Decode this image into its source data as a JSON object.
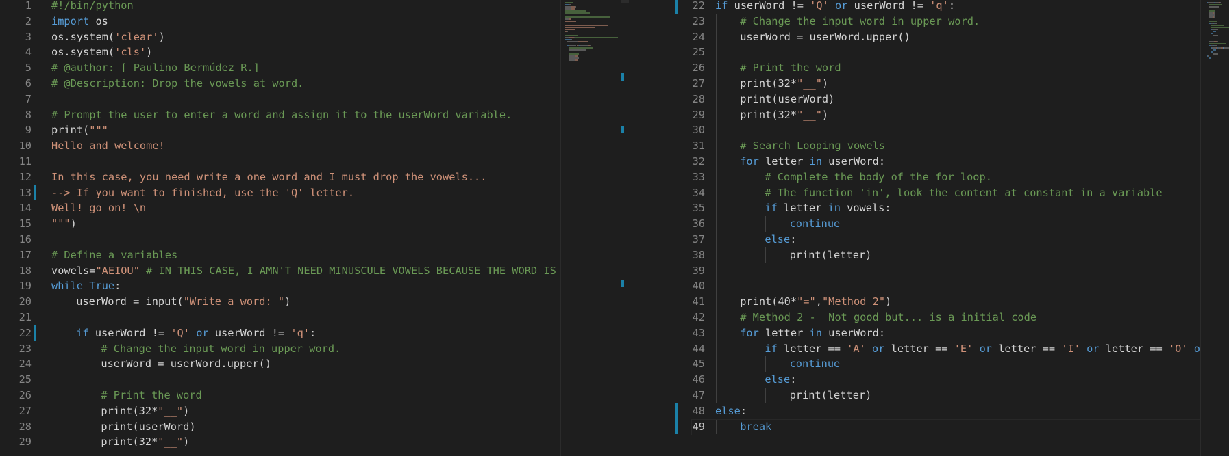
{
  "editor": {
    "language": "python",
    "colors": {
      "background": "#1e1e1e",
      "keyword": "#569cd6",
      "string": "#ce9178",
      "comment": "#6a9955",
      "text": "#d4d4d4",
      "line_number": "#858585",
      "modified_marker": "#1b81a8"
    },
    "left_pane": {
      "lines": [
        {
          "n": "1",
          "indent": 0,
          "t": [
            [
              "c",
              "#!/bin/python"
            ]
          ]
        },
        {
          "n": "2",
          "indent": 0,
          "t": [
            [
              "k",
              "import"
            ],
            [
              "p",
              " os"
            ]
          ]
        },
        {
          "n": "3",
          "indent": 0,
          "t": [
            [
              "p",
              "os.system("
            ],
            [
              "s",
              "'clear'"
            ],
            [
              "p",
              ")"
            ]
          ]
        },
        {
          "n": "4",
          "indent": 0,
          "t": [
            [
              "p",
              "os.system("
            ],
            [
              "s",
              "'cls'"
            ],
            [
              "p",
              ")"
            ]
          ]
        },
        {
          "n": "5",
          "indent": 0,
          "t": [
            [
              "c",
              "# @author: [ Paulino Bermúdez R.]"
            ]
          ]
        },
        {
          "n": "6",
          "indent": 0,
          "t": [
            [
              "c",
              "# @Description: Drop the vowels at word."
            ]
          ]
        },
        {
          "n": "7",
          "indent": 0,
          "t": []
        },
        {
          "n": "8",
          "indent": 0,
          "t": [
            [
              "c",
              "# Prompt the user to enter a word and assign it to the userWord variable."
            ]
          ]
        },
        {
          "n": "9",
          "indent": 0,
          "t": [
            [
              "p",
              "print("
            ],
            [
              "s",
              "\"\"\""
            ]
          ]
        },
        {
          "n": "10",
          "indent": 0,
          "t": [
            [
              "s",
              "Hello and welcome!"
            ]
          ]
        },
        {
          "n": "11",
          "indent": 0,
          "t": []
        },
        {
          "n": "12",
          "indent": 0,
          "t": [
            [
              "s",
              "In this case, you need write a one word and I must drop the vowels..."
            ]
          ]
        },
        {
          "n": "13",
          "indent": 0,
          "t": [
            [
              "s",
              "--> If you want to finished, use the 'Q' letter."
            ]
          ],
          "modified": true
        },
        {
          "n": "14",
          "indent": 0,
          "t": [
            [
              "s",
              "Well! go on! \\n"
            ]
          ]
        },
        {
          "n": "15",
          "indent": 0,
          "t": [
            [
              "s",
              "\"\"\""
            ],
            [
              "p",
              ")"
            ]
          ]
        },
        {
          "n": "16",
          "indent": 0,
          "t": []
        },
        {
          "n": "17",
          "indent": 0,
          "t": [
            [
              "c",
              "# Define a variables"
            ]
          ]
        },
        {
          "n": "18",
          "indent": 0,
          "t": [
            [
              "p",
              "vowels="
            ],
            [
              "s",
              "\"AEIOU\""
            ],
            [
              "p",
              " "
            ],
            [
              "c",
              "# IN THIS CASE, I AMN'T NEED MINUSCULE VOWELS BECAUSE THE WORD IS UPPER"
            ]
          ]
        },
        {
          "n": "19",
          "indent": 0,
          "t": [
            [
              "k",
              "while"
            ],
            [
              "p",
              " "
            ],
            [
              "k",
              "True"
            ],
            [
              "p",
              ":"
            ]
          ]
        },
        {
          "n": "20",
          "indent": 1,
          "t": [
            [
              "p",
              "userWord = input("
            ],
            [
              "s",
              "\"Write a word: \""
            ],
            [
              "p",
              ")"
            ]
          ]
        },
        {
          "n": "21",
          "indent": 1,
          "t": []
        },
        {
          "n": "22",
          "indent": 1,
          "t": [
            [
              "k",
              "if"
            ],
            [
              "p",
              " userWord != "
            ],
            [
              "s",
              "'Q'"
            ],
            [
              "p",
              " "
            ],
            [
              "k",
              "or"
            ],
            [
              "p",
              " userWord != "
            ],
            [
              "s",
              "'q'"
            ],
            [
              "p",
              ":"
            ]
          ],
          "modified": true
        },
        {
          "n": "23",
          "indent": 2,
          "t": [
            [
              "c",
              "# Change the input word in upper word."
            ]
          ]
        },
        {
          "n": "24",
          "indent": 2,
          "t": [
            [
              "p",
              "userWord = userWord.upper()"
            ]
          ]
        },
        {
          "n": "25",
          "indent": 2,
          "t": []
        },
        {
          "n": "26",
          "indent": 2,
          "t": [
            [
              "c",
              "# Print the word"
            ]
          ]
        },
        {
          "n": "27",
          "indent": 2,
          "t": [
            [
              "p",
              "print(32*"
            ],
            [
              "s",
              "\"__\""
            ],
            [
              "p",
              ")"
            ]
          ]
        },
        {
          "n": "28",
          "indent": 2,
          "t": [
            [
              "p",
              "print(userWord)"
            ]
          ]
        },
        {
          "n": "29",
          "indent": 2,
          "t": [
            [
              "p",
              "print(32*"
            ],
            [
              "s",
              "\"__\""
            ],
            [
              "p",
              ")"
            ]
          ]
        }
      ]
    },
    "right_pane": {
      "lines": [
        {
          "n": "22",
          "indent": 1,
          "t": [
            [
              "k",
              "if"
            ],
            [
              "p",
              " userWord != "
            ],
            [
              "s",
              "'Q'"
            ],
            [
              "p",
              " "
            ],
            [
              "k",
              "or"
            ],
            [
              "p",
              " userWord != "
            ],
            [
              "s",
              "'q'"
            ],
            [
              "p",
              ":"
            ]
          ],
          "modified": true
        },
        {
          "n": "23",
          "indent": 2,
          "t": [
            [
              "c",
              "# Change the input word in upper word."
            ]
          ]
        },
        {
          "n": "24",
          "indent": 2,
          "t": [
            [
              "p",
              "userWord = userWord.upper()"
            ]
          ]
        },
        {
          "n": "25",
          "indent": 2,
          "t": []
        },
        {
          "n": "26",
          "indent": 2,
          "t": [
            [
              "c",
              "# Print the word"
            ]
          ]
        },
        {
          "n": "27",
          "indent": 2,
          "t": [
            [
              "p",
              "print(32*"
            ],
            [
              "s",
              "\"__\""
            ],
            [
              "p",
              ")"
            ]
          ]
        },
        {
          "n": "28",
          "indent": 2,
          "t": [
            [
              "p",
              "print(userWord)"
            ]
          ]
        },
        {
          "n": "29",
          "indent": 2,
          "t": [
            [
              "p",
              "print(32*"
            ],
            [
              "s",
              "\"__\""
            ],
            [
              "p",
              ")"
            ]
          ]
        },
        {
          "n": "30",
          "indent": 2,
          "t": []
        },
        {
          "n": "31",
          "indent": 2,
          "t": [
            [
              "c",
              "# Search Looping vowels"
            ]
          ]
        },
        {
          "n": "32",
          "indent": 2,
          "t": [
            [
              "k",
              "for"
            ],
            [
              "p",
              " letter "
            ],
            [
              "k",
              "in"
            ],
            [
              "p",
              " userWord:"
            ]
          ]
        },
        {
          "n": "33",
          "indent": 3,
          "t": [
            [
              "c",
              "# Complete the body of the for loop."
            ]
          ]
        },
        {
          "n": "34",
          "indent": 3,
          "t": [
            [
              "c",
              "# The function 'in', look the content at constant in a variable"
            ]
          ]
        },
        {
          "n": "35",
          "indent": 3,
          "t": [
            [
              "k",
              "if"
            ],
            [
              "p",
              " letter "
            ],
            [
              "k",
              "in"
            ],
            [
              "p",
              " vowels:"
            ]
          ]
        },
        {
          "n": "36",
          "indent": 4,
          "t": [
            [
              "k",
              "continue"
            ]
          ]
        },
        {
          "n": "37",
          "indent": 3,
          "t": [
            [
              "k",
              "else"
            ],
            [
              "p",
              ":"
            ]
          ]
        },
        {
          "n": "38",
          "indent": 4,
          "t": [
            [
              "p",
              "print(letter)"
            ]
          ]
        },
        {
          "n": "39",
          "indent": 2,
          "t": []
        },
        {
          "n": "40",
          "indent": 2,
          "t": []
        },
        {
          "n": "41",
          "indent": 2,
          "t": [
            [
              "p",
              "print(40*"
            ],
            [
              "s",
              "\"=\""
            ],
            [
              "p",
              ","
            ],
            [
              "s",
              "\"Method 2\""
            ],
            [
              "p",
              ")"
            ]
          ]
        },
        {
          "n": "42",
          "indent": 2,
          "t": [
            [
              "c",
              "# Method 2 -  Not good but... is a initial code"
            ]
          ]
        },
        {
          "n": "43",
          "indent": 2,
          "t": [
            [
              "k",
              "for"
            ],
            [
              "p",
              " letter "
            ],
            [
              "k",
              "in"
            ],
            [
              "p",
              " userWord:"
            ]
          ]
        },
        {
          "n": "44",
          "indent": 3,
          "t": [
            [
              "k",
              "if"
            ],
            [
              "p",
              " letter == "
            ],
            [
              "s",
              "'A'"
            ],
            [
              "p",
              " "
            ],
            [
              "k",
              "or"
            ],
            [
              "p",
              " letter == "
            ],
            [
              "s",
              "'E'"
            ],
            [
              "p",
              " "
            ],
            [
              "k",
              "or"
            ],
            [
              "p",
              " letter == "
            ],
            [
              "s",
              "'I'"
            ],
            [
              "p",
              " "
            ],
            [
              "k",
              "or"
            ],
            [
              "p",
              " letter == "
            ],
            [
              "s",
              "'O'"
            ],
            [
              "p",
              " "
            ],
            [
              "k",
              "or"
            ]
          ]
        },
        {
          "n": "45",
          "indent": 4,
          "t": [
            [
              "k",
              "continue"
            ]
          ]
        },
        {
          "n": "46",
          "indent": 3,
          "t": [
            [
              "k",
              "else"
            ],
            [
              "p",
              ":"
            ]
          ]
        },
        {
          "n": "47",
          "indent": 4,
          "t": [
            [
              "p",
              "print(letter)"
            ]
          ]
        },
        {
          "n": "48",
          "indent": 1,
          "t": [
            [
              "k",
              "else"
            ],
            [
              "p",
              ":"
            ]
          ],
          "modified": true
        },
        {
          "n": "49",
          "indent": 2,
          "t": [
            [
              "k",
              "break"
            ]
          ],
          "modified": true,
          "current": true
        }
      ]
    }
  }
}
